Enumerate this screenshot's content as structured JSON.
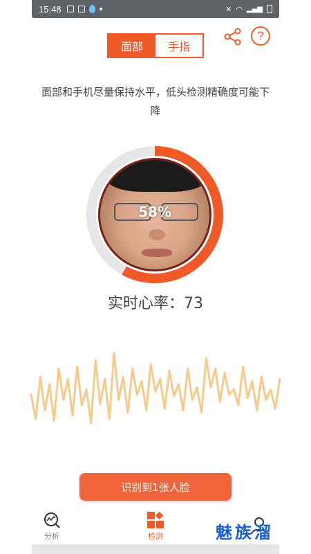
{
  "status_bar": {
    "time": "15:48"
  },
  "mode_toggle": {
    "face_label": "面部",
    "finger_label": "手指",
    "active": "face"
  },
  "header_icons": {
    "share": "share-icon",
    "help_glyph": "?"
  },
  "hint": {
    "text": "面部和手机尽量保持水平，低头检测精确度可能下降"
  },
  "progress": {
    "value": 0.58,
    "label": "58%"
  },
  "heart_rate": {
    "label": "实时心率：",
    "value": "73"
  },
  "detect_button": {
    "label": "识别到1张人脸"
  },
  "bottom_nav": {
    "items": [
      {
        "label": "分析",
        "icon": "analysis-icon",
        "active": false
      },
      {
        "label": "检测",
        "icon": "detect-icon",
        "active": true
      },
      {
        "label": "",
        "icon": "profile-icon",
        "active": false
      }
    ]
  },
  "watermark": {
    "title": "魅族溜",
    "url": "www.mz6.net"
  },
  "colors": {
    "accent": "#f05a28",
    "button": "#f0643c",
    "wave": "#f7c98a",
    "ring_track": "#e6e6e6"
  },
  "waveform": {
    "values": [
      0.45,
      0.22,
      0.62,
      0.3,
      0.55,
      0.2,
      0.7,
      0.4,
      0.6,
      0.25,
      0.72,
      0.35,
      0.5,
      0.18,
      0.78,
      0.36,
      0.6,
      0.22,
      0.85,
      0.4,
      0.62,
      0.28,
      0.7,
      0.45,
      0.58,
      0.3,
      0.74,
      0.48,
      0.6,
      0.32,
      0.68,
      0.44,
      0.55,
      0.3,
      0.7,
      0.4,
      0.52,
      0.28,
      0.8,
      0.52,
      0.7,
      0.38,
      0.66,
      0.45,
      0.5,
      0.35,
      0.72,
      0.42,
      0.58,
      0.3,
      0.62,
      0.4,
      0.5,
      0.32,
      0.6
    ]
  }
}
